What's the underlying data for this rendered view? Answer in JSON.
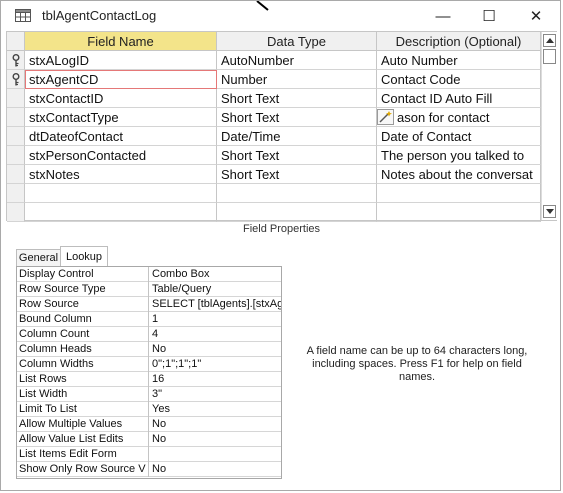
{
  "window": {
    "title": "tblAgentContactLog",
    "controls": {
      "minimize_glyph": "—",
      "maximize_glyph": "☐",
      "close_glyph": "✕"
    }
  },
  "grid": {
    "columns": [
      "Field Name",
      "Data Type",
      "Description (Optional)"
    ],
    "rows": [
      {
        "field": "stxALogID",
        "type": "AutoNumber",
        "description": "Auto Number",
        "primary_key": true
      },
      {
        "field": "stxAgentCD",
        "type": "Number",
        "description": "Contact Code",
        "primary_key": true,
        "active": true
      },
      {
        "field": "stxContactID",
        "type": "Short Text",
        "description": "Contact ID Auto Fill"
      },
      {
        "field": "stxContactType",
        "type": "Short Text",
        "description": "ason for contact",
        "builder_button": true
      },
      {
        "field": "dtDateofContact",
        "type": "Date/Time",
        "description": "Date of Contact"
      },
      {
        "field": "stxPersonContacted",
        "type": "Short Text",
        "description": "The person you talked to"
      },
      {
        "field": "stxNotes",
        "type": "Short Text",
        "description": "Notes about the conversat"
      }
    ],
    "empty_rows": 2,
    "colors": {
      "selected_header": "#f3e48a",
      "active_cell_border": "#e57878"
    }
  },
  "field_properties_label": "Field Properties",
  "tabs": [
    {
      "label": "General",
      "selected": false
    },
    {
      "label": "Lookup",
      "selected": true
    }
  ],
  "properties": [
    {
      "name": "Display Control",
      "value": "Combo Box"
    },
    {
      "name": "Row Source Type",
      "value": "Table/Query"
    },
    {
      "name": "Row Source",
      "value": "SELECT [tblAgents].[stxAg"
    },
    {
      "name": "Bound Column",
      "value": "1"
    },
    {
      "name": "Column Count",
      "value": "4"
    },
    {
      "name": "Column Heads",
      "value": "No"
    },
    {
      "name": "Column Widths",
      "value": "0\";1\";1\";1\""
    },
    {
      "name": "List Rows",
      "value": "16"
    },
    {
      "name": "List Width",
      "value": "3\""
    },
    {
      "name": "Limit To List",
      "value": "Yes"
    },
    {
      "name": "Allow Multiple Values",
      "value": "No"
    },
    {
      "name": "Allow Value List Edits",
      "value": "No"
    },
    {
      "name": "List Items Edit Form",
      "value": ""
    },
    {
      "name": "Show Only Row Source V",
      "value": "No"
    }
  ],
  "help_text": "A field name can be up to 64 characters long, including spaces. Press F1 for help on field names."
}
